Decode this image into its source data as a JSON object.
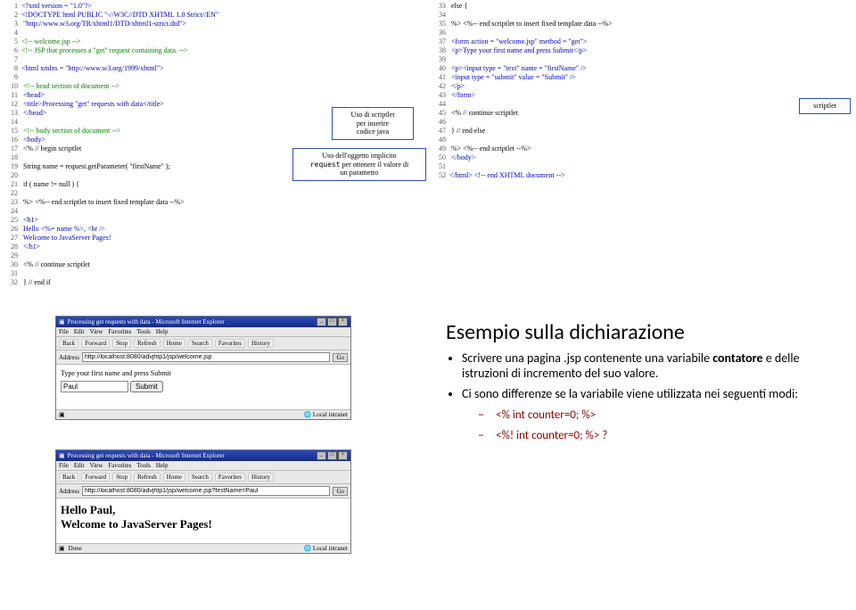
{
  "code_left": [
    "<?xml version = \"1.0\"?>",
    "<!DOCTYPE html PUBLIC \"-//W3C//DTD XHTML 1.0 Strict//EN\"",
    "   \"http://www.w3.org/TR/xhtml1/DTD/xhtml1-strict.dtd\">",
    "",
    "<!-- welcome.jsp -->",
    "<!-- JSP that processes a \"get\" request containing data. -->",
    "",
    "<html xmlns = \"http://www.w3.org/1999/xhtml\">",
    "",
    "   <!-- head section of document -->",
    "   <head>",
    "      <title>Processing \"get\" requests with data</title>",
    "   </head>",
    "",
    "   <!-- body section of document -->",
    "   <body>",
    "      <% // begin scriptlet",
    "",
    "         String name = request.getParameter( \"firstName\" );",
    "",
    "         if ( name != null ) {",
    "",
    "      %> <%-- end scriptlet to insert fixed template data --%>",
    "",
    "            <h1>",
    "               Hello <%= name %>, <br />",
    "               Welcome to JavaServer Pages!",
    "            </h1>",
    "",
    "      <% // continue scriptlet",
    "",
    "         }  // end if"
  ],
  "code_right": [
    "         else {",
    "",
    "      %> <%-- end scriptlet to insert fixed template data --%>",
    "",
    "            <form action = \"welcome.jsp\" method = \"get\">",
    "               <p>Type your first name and press Submit</p>",
    "",
    "               <p><input type = \"text\" name = \"firstName\" />",
    "                  <input type = \"submit\" value = \"Submit\" />",
    "               </p>",
    "            </form>",
    "",
    "      <% // continue scriptlet",
    "",
    "         }  // end else",
    "",
    "      %> <%-- end scriptlet --%>",
    "   </body>",
    "",
    "</html>  <!-- end XHTML document -->"
  ],
  "code_right_start": 33,
  "anno1": {
    "l1": "Uso di scriptlet",
    "l2": "per inserire",
    "l3": "codice java"
  },
  "anno2": {
    "l1": "Uso dell'oggetto implicito",
    "l2_a": "request",
    "l2_b": " per ottenere il valore di",
    "l3": "un parametro"
  },
  "anno3": "scriptlet",
  "browser": {
    "title": "Processing get requests with data - Microsoft Internet Explorer",
    "menus": [
      "File",
      "Edit",
      "View",
      "Favorites",
      "Tools",
      "Help"
    ],
    "tb": [
      "Back",
      "Forward",
      "Stop",
      "Refresh",
      "Home",
      "Search",
      "Favorites",
      "History"
    ],
    "addr_label": "Address",
    "go": "Go",
    "url1": "http://localhost:8080/advjhtp1/jsp/welcome.jsp",
    "url2": "http://localhost:8080/advjhtp1/jsp/welcome.jsp?firstName=Paul",
    "prompt": "Type your first name and press Submit",
    "input_value": "Paul",
    "submit": "Submit",
    "hello1": "Hello Paul,",
    "hello2": "Welcome to JavaServer Pages!",
    "status_done": "Done",
    "status_zone": "Local intranet"
  },
  "br": {
    "title": "Esempio sulla dichiarazione",
    "b1a": "Scrivere una pagina .jsp contenente una variabile ",
    "b1b": "contatore",
    "b1c": " e delle istruzioni di incremento del suo valore.",
    "b2": "Ci sono differenze se la variabile viene utilizzata nei seguenti modi:",
    "s1": "<% int counter=0; %>",
    "s2": "<%! int counter=0; %> ?"
  }
}
